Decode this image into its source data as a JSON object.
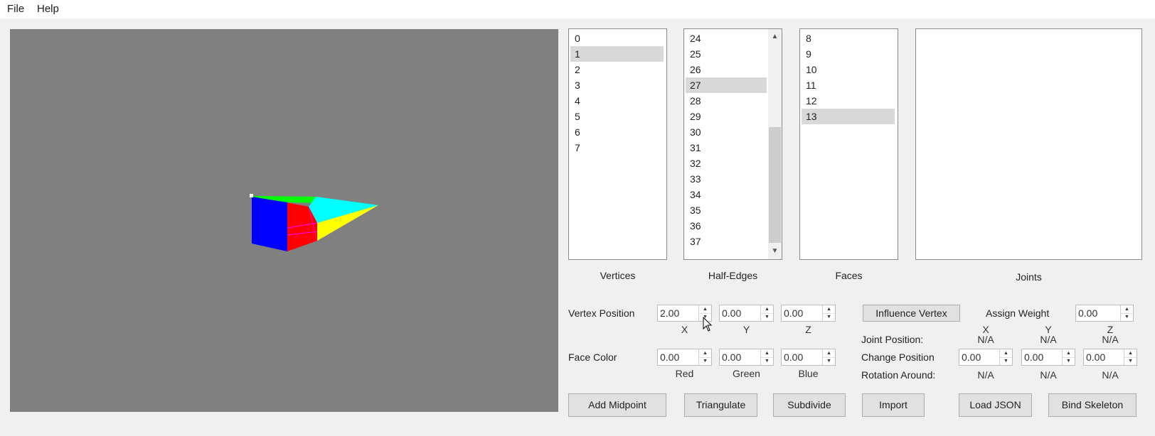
{
  "menu": {
    "file": "File",
    "help": "Help"
  },
  "lists": {
    "vertices": {
      "caption": "Vertices",
      "items": [
        "0",
        "1",
        "2",
        "3",
        "4",
        "5",
        "6",
        "7"
      ],
      "selected": "1"
    },
    "half_edges": {
      "caption": "Half-Edges",
      "items": [
        "24",
        "25",
        "26",
        "27",
        "28",
        "29",
        "30",
        "31",
        "32",
        "33",
        "34",
        "35",
        "36",
        "37"
      ],
      "selected": "27"
    },
    "faces": {
      "caption": "Faces",
      "items": [
        "8",
        "9",
        "10",
        "11",
        "12",
        "13"
      ],
      "selected": "13"
    },
    "joints": {
      "caption": "Joints",
      "items": []
    }
  },
  "vertex_position": {
    "label": "Vertex Position",
    "x": "2.00",
    "y": "0.00",
    "z": "0.00",
    "x_label": "X",
    "y_label": "Y",
    "z_label": "Z"
  },
  "face_color": {
    "label": "Face Color",
    "red": "0.00",
    "green": "0.00",
    "blue": "0.00",
    "red_label": "Red",
    "green_label": "Green",
    "blue_label": "Blue"
  },
  "joint_panel": {
    "influence_button": "Influence Vertex",
    "assign_weight_label": "Assign Weight",
    "assign_weight_value": "0.00",
    "x_label": "X",
    "y_label": "Y",
    "z_label": "Z",
    "joint_position_label": "Joint Position:",
    "joint_position": [
      "N/A",
      "N/A",
      "N/A"
    ],
    "change_position_label": "Change Position",
    "change_position": [
      "0.00",
      "0.00",
      "0.00"
    ],
    "rotation_around_label": "Rotation Around:",
    "rotation_around": [
      "N/A",
      "N/A",
      "N/A"
    ]
  },
  "buttons": {
    "add_midpoint": "Add Midpoint",
    "triangulate": "Triangulate",
    "subdivide": "Subdivide",
    "import": "Import",
    "load_json": "Load JSON",
    "bind_skeleton": "Bind Skeleton"
  },
  "icons": {
    "spin_up": "spin-up-arrow",
    "spin_down": "spin-down-arrow",
    "scroll_up": "scroll-up-arrow",
    "scroll_down": "scroll-down-arrow",
    "cursor": "mouse-pointer"
  },
  "colors": {
    "viewport_bg": "#808080",
    "face_blue": "#0000ff",
    "face_red": "#ff0000",
    "face_cyan": "#00ffff",
    "face_yellow": "#ffff00",
    "face_green": "#00ff00",
    "face_magenta": "#ff00ff",
    "selection": "#d9d9d9"
  }
}
